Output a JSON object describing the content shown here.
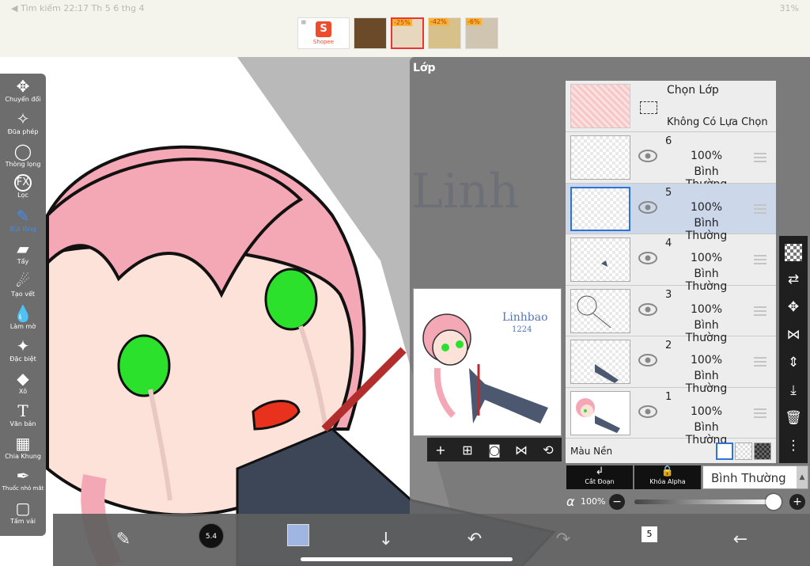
{
  "status": {
    "left": "◀ Tìm kiếm   22:17   Th 5 6 thg 4",
    "right": "31%"
  },
  "ad": {
    "menu_icon": "menu-icon",
    "shopee_label": "Shopee",
    "badges": [
      "-25%",
      "-42%",
      "-6%"
    ]
  },
  "toolbar": {
    "items": [
      {
        "label": "Chuyển đổi",
        "icon": "✥",
        "name": "transform"
      },
      {
        "label": "Đũa phép",
        "icon": "✧",
        "name": "magic-wand"
      },
      {
        "label": "Thòng lọng",
        "icon": "◯",
        "name": "lasso"
      },
      {
        "label": "Lọc",
        "icon": "FX",
        "name": "filter"
      },
      {
        "label": "Bút lông",
        "icon": "✎",
        "name": "brush"
      },
      {
        "label": "Tẩy",
        "icon": "▰",
        "name": "eraser"
      },
      {
        "label": "Tạo vết",
        "icon": "☄",
        "name": "smudge"
      },
      {
        "label": "Làm mờ",
        "icon": "💧",
        "name": "blur"
      },
      {
        "label": "Đặc biệt",
        "icon": "✦",
        "name": "special"
      },
      {
        "label": "Xô",
        "icon": "◆",
        "name": "bucket"
      },
      {
        "label": "Văn bản",
        "icon": "T",
        "name": "text"
      },
      {
        "label": "Chia Khung",
        "icon": "▦",
        "name": "frame-divider"
      },
      {
        "label": "Thuốc nhỏ mắt",
        "icon": "✒",
        "name": "eyedropper"
      },
      {
        "label": "Tấm vải",
        "icon": "▢",
        "name": "canvas"
      }
    ]
  },
  "layer_panel": {
    "title": "Lớp",
    "select": {
      "title": "Chọn Lớp",
      "sub": "Không Có Lựa Chọn"
    },
    "layers": [
      {
        "num": "6",
        "opacity": "100%",
        "blend": "Bình Thường",
        "active": false
      },
      {
        "num": "5",
        "opacity": "100%",
        "blend": "Bình Thường",
        "active": true
      },
      {
        "num": "4",
        "opacity": "100%",
        "blend": "Bình Thường",
        "active": false
      },
      {
        "num": "3",
        "opacity": "100%",
        "blend": "Bình Thường",
        "active": false
      },
      {
        "num": "2",
        "opacity": "100%",
        "blend": "Bình Thường",
        "active": false
      },
      {
        "num": "1",
        "opacity": "100%",
        "blend": "Bình Thường",
        "active": false
      }
    ],
    "background_label": "Màu Nền",
    "clip_label": "Cắt Đoạn",
    "alpha_lock_label": "Khóa Alpha",
    "blend_mode": "Bình Thường",
    "alpha_symbol": "α",
    "alpha_value": "100%",
    "alpha_fraction": 0.98
  },
  "bottombar": {
    "brush_size": "5.4",
    "layer_count": "5"
  },
  "colors": {
    "accent": "#2d74d6",
    "current_color": "#9fb6e2",
    "toolbar": "#6d6d6d"
  }
}
